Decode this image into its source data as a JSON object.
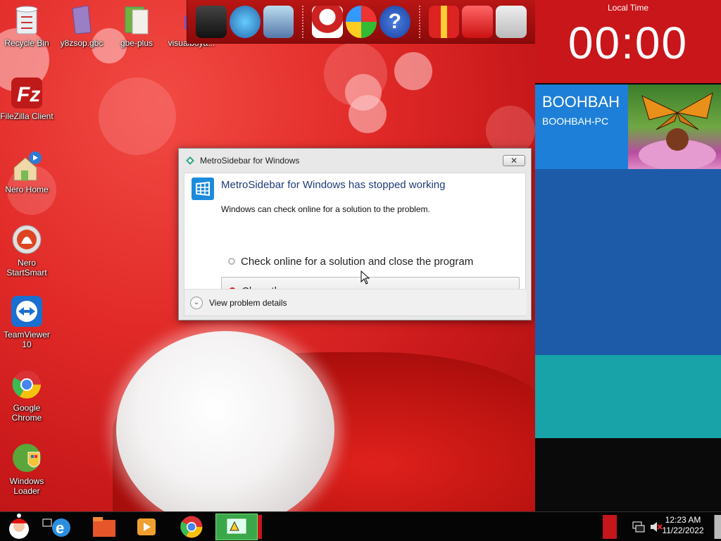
{
  "desktop": {
    "icons": [
      {
        "label": "Recycle Bin"
      },
      {
        "label": "y8zsop.gbc"
      },
      {
        "label": "gbe-plus"
      },
      {
        "label": "visualboya..."
      },
      {
        "label": "FileZilla Client"
      },
      {
        "label": "Nero Home"
      },
      {
        "label": "Nero StartSmart"
      },
      {
        "label": "TeamViewer 10"
      },
      {
        "label": "Google Chrome"
      },
      {
        "label": "Windows Loader"
      }
    ]
  },
  "sidebar": {
    "clock_caption": "Local Time",
    "clock_time": "00:00",
    "user_name": "BOOHBAH",
    "computer_name": "BOOHBAH-PC"
  },
  "dialog": {
    "title": "MetroSidebar for Windows",
    "close_glyph": "✕",
    "heading": "MetroSidebar for Windows has stopped working",
    "subtext": "Windows can check online for a solution to the problem.",
    "option_check": "Check online for a solution and close the program",
    "option_close": "Close the program",
    "details": "View problem details"
  },
  "taskbar": {
    "time": "12:23 AM",
    "date": "11/22/2022"
  },
  "colors": {
    "wallpaper_red": "#e12a28",
    "clock_red": "#c8161a",
    "user_blue": "#1e7fd8",
    "tile_blue": "#1d5ba8",
    "tile_teal": "#17a3a7",
    "dialog_heading": "#1f3a78"
  }
}
